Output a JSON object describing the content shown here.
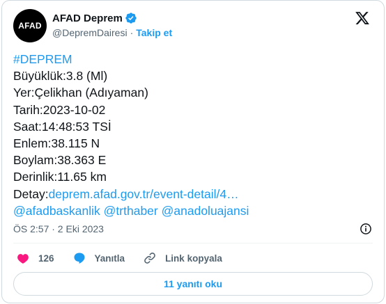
{
  "author": {
    "avatar_text": "AFAD",
    "display_name": "AFAD Deprem",
    "handle": "@DepremDairesi",
    "separator": "·",
    "follow_label": "Takip et"
  },
  "tweet": {
    "hashtag": "#DEPREM",
    "lines": [
      "Büyüklük:3.8 (Ml)",
      "Yer:Çelikhan (Adıyaman)",
      "Tarih:2023-10-02",
      "Saat:14:48:53 TSİ",
      "Enlem:38.115 N",
      "Boylam:38.363 E",
      "Derinlik:11.65 km"
    ],
    "detail_prefix": "Detay:",
    "detail_link": "deprem.afad.gov.tr/event-detail/4…",
    "mentions": [
      "@afadbaskanlik",
      "@trthaber",
      "@anadoluajansi"
    ]
  },
  "meta": {
    "timestamp": "ÖS 2:57 · 2 Eki 2023"
  },
  "actions": {
    "likes": "126",
    "reply_label": "Yanıtla",
    "copy_link_label": "Link kopyala"
  },
  "read_replies_label": "11 yanıtı oku",
  "colors": {
    "accent": "#1d9bf0",
    "like": "#f91880",
    "text": "#0f1419",
    "muted": "#536471"
  },
  "icons": [
    "verified-badge-icon",
    "x-logo-icon",
    "info-icon",
    "heart-icon",
    "reply-bubble-icon",
    "link-icon"
  ]
}
